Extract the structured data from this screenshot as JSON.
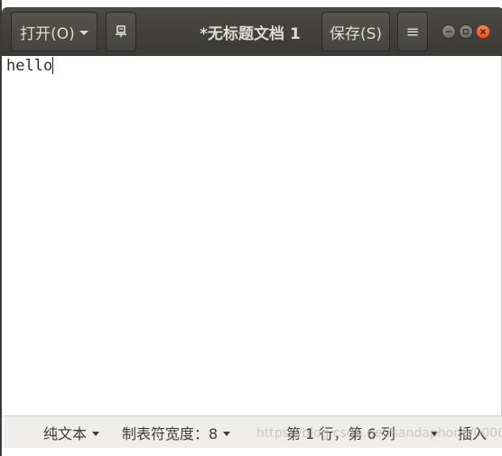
{
  "headerbar": {
    "open_label": "打开(O)",
    "title": "*无标题文档 1",
    "save_label": "保存(S)",
    "menu_glyph": "≡"
  },
  "editor": {
    "content": "hello"
  },
  "statusbar": {
    "language": "纯文本",
    "tab_width": "制表符宽度：8",
    "position": "第 1 行，第 6 列",
    "mode": "插入"
  },
  "watermark": "https://blog.csdn.net/sandaphone/0000",
  "colors": {
    "header_bg": "#3c3b37",
    "close_button": "#e9592d",
    "status_bg": "#efeeec"
  },
  "icons": {
    "pin": "pin-icon",
    "menu": "hamburger-menu-icon",
    "minimize": "minimize-icon",
    "maximize": "maximize-icon",
    "close": "close-icon"
  }
}
